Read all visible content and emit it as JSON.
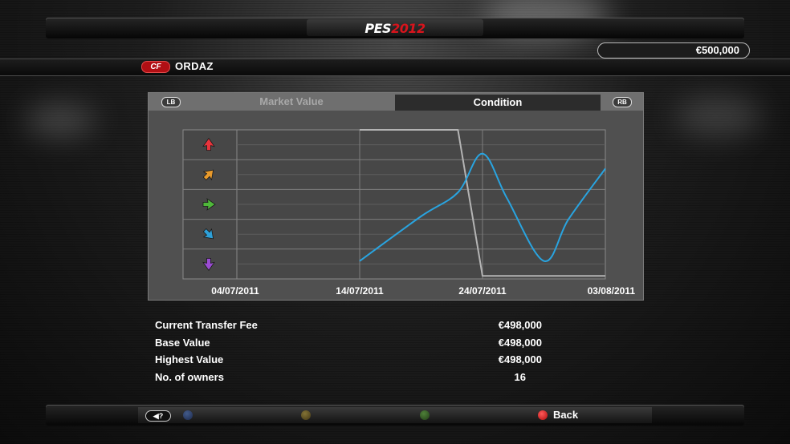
{
  "header": {
    "logo_main": "PES",
    "logo_year": "2012",
    "money": "€500,000"
  },
  "player": {
    "position": "CF",
    "name": "ORDAZ"
  },
  "tabs": {
    "lb": "LB",
    "rb": "RB",
    "market_value": "Market Value",
    "condition": "Condition",
    "active": "Condition"
  },
  "chart_data": {
    "type": "line",
    "title": "",
    "x_ticks": [
      "04/07/2011",
      "14/07/2011",
      "24/07/2011",
      "03/08/2011"
    ],
    "y_levels": [
      "excellent",
      "good",
      "normal",
      "poor",
      "terrible"
    ],
    "y_level_icons": [
      "arrow-up-red-icon",
      "arrow-up-right-orange-icon",
      "arrow-right-green-icon",
      "arrow-down-right-blue-icon",
      "arrow-down-purple-icon"
    ],
    "y_scale": "1 = bottom level (purple), 5 = top level (red)",
    "ylim": [
      1,
      5
    ],
    "series": [
      {
        "color": "#29a4e0",
        "x": [
          "14/07/2011",
          "19/07/2011",
          "22/07/2011",
          "24/07/2011",
          "26/07/2011",
          "29/07/2011",
          "31/07/2011",
          "03/08/2011"
        ],
        "y": [
          1.1,
          2.6,
          3.4,
          4.7,
          3.2,
          1.1,
          2.5,
          4.2
        ]
      },
      {
        "color": "#b4b4b4",
        "x": [
          "14/07/2011",
          "22/07/2011",
          "24/07/2011",
          "03/08/2011"
        ],
        "y": [
          5.5,
          5.5,
          0.6,
          0.6
        ]
      }
    ]
  },
  "stats": [
    {
      "label": "Current Transfer Fee",
      "value": "€498,000"
    },
    {
      "label": "Base Value",
      "value": "€498,000"
    },
    {
      "label": "Highest Value",
      "value": "€498,000"
    },
    {
      "label": "No. of owners",
      "value": "16"
    }
  ],
  "footer": {
    "help_label": "?",
    "back_label": "Back"
  }
}
